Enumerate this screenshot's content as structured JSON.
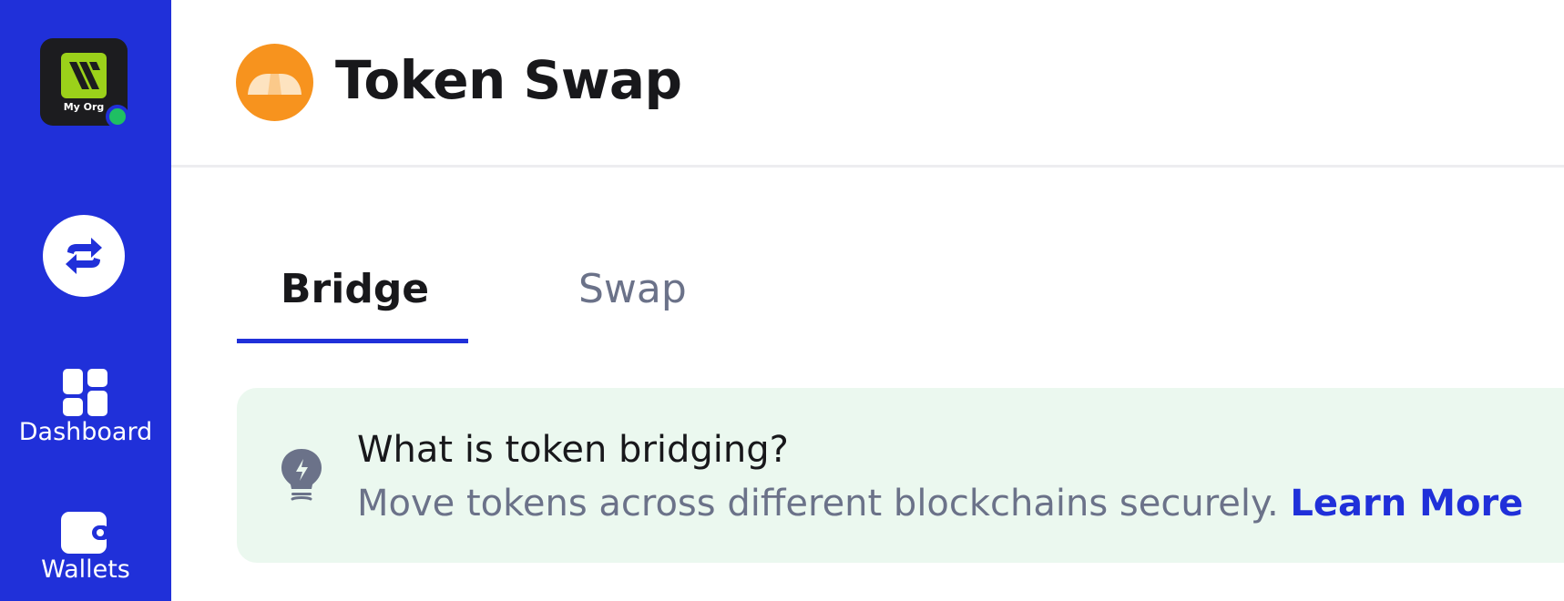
{
  "sidebar": {
    "org_name": "My Org",
    "nav": [
      {
        "label": "Dashboard",
        "icon": "dashboard-icon"
      },
      {
        "label": "Wallets",
        "icon": "wallet-icon"
      }
    ],
    "active_icon": "swap-arrows-icon",
    "status_color": "#1fbf63"
  },
  "header": {
    "title": "Token Swap",
    "brand_icon": "token-swap-logo-icon"
  },
  "tabs": [
    {
      "label": "Bridge",
      "active": true
    },
    {
      "label": "Swap",
      "active": false
    }
  ],
  "info": {
    "heading": "What is token bridging?",
    "body": "Move tokens across different blockchains securely.",
    "link": "Learn More",
    "icon": "lightbulb-icon"
  },
  "colors": {
    "sidebar": "#2030d9",
    "accent": "#2030d9",
    "info_bg": "#ebf8ef",
    "brand_orange": "#f7931e"
  }
}
